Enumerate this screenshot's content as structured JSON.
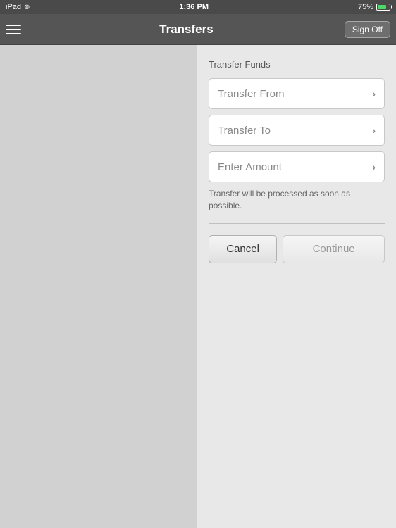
{
  "status_bar": {
    "device": "iPad",
    "time": "1:36 PM",
    "battery_percent": "75%",
    "battery_label": "75% +"
  },
  "nav_bar": {
    "title": "Transfers",
    "sign_off_label": "Sign Off",
    "menu_icon": "menu-icon"
  },
  "right_panel": {
    "section_title": "Transfer Funds",
    "form_rows": [
      {
        "label": "Transfer From",
        "chevron": "›"
      },
      {
        "label": "Transfer To",
        "chevron": "›"
      },
      {
        "label": "Enter Amount",
        "chevron": "›"
      }
    ],
    "info_text": "Transfer will be processed as soon as possible.",
    "cancel_label": "Cancel",
    "continue_label": "Continue"
  }
}
